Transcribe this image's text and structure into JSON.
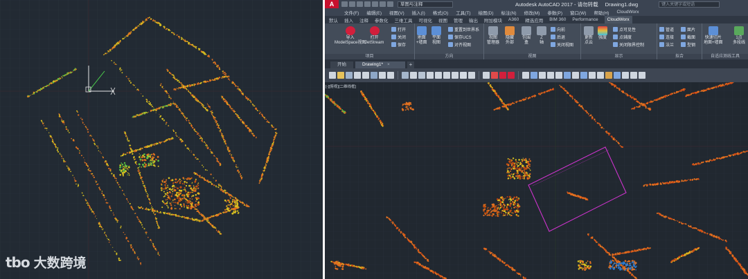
{
  "watermark": {
    "logo_text": "tbo",
    "text": "大数跨境"
  },
  "autocad": {
    "app_logo": "A",
    "workspace": "草图与注释",
    "title": "Autodesk AutoCAD 2017 - 请勿转载",
    "filename": "Drawing1.dwg",
    "search_placeholder": "键入关键字或短语",
    "menu": [
      "文件(F)",
      "编辑(E)",
      "视图(V)",
      "插入(I)",
      "格式(O)",
      "工具(T)",
      "绘图(D)",
      "标注(N)",
      "修改(M)",
      "参数(P)",
      "窗口(W)",
      "帮助(H)",
      "CloudWorx"
    ],
    "ribbon_tabs": [
      "默认",
      "插入",
      "注释",
      "参数化",
      "三维工具",
      "可视化",
      "视图",
      "管理",
      "输出",
      "附加模块",
      "A360",
      "精选应用",
      "BIM 360",
      "Performance",
      "CloudWorx"
    ],
    "ribbon_active_tab": "CloudWorx",
    "ribbon": {
      "import_label": "导入",
      "import_sub": "ModelSpace视图",
      "open_label": "打开",
      "open_sub": "JetStream",
      "small_open": "打开",
      "small_close": "关闭",
      "small_save": "保存",
      "project_panel": "项目",
      "ground_label": "地面",
      "ground_sub": "+墙面",
      "plane_label": "平面",
      "plane_sub": "视图",
      "reset_ucs": "重置到世界系",
      "save_ucs": "保存UCS",
      "align_view": "对齐视图",
      "direction_panel": "方向",
      "viewport_label": "视图",
      "viewport_sub": "管理器",
      "hide_label": "隐藏",
      "hide_sub": "外部",
      "bbox_label": "包围",
      "bbox_sub": "盒",
      "z_label": "Z",
      "z_sub": "轴",
      "fwd": "向前",
      "back": "后退",
      "close_view": "关闭视图",
      "view_panel": "视图",
      "update_label": "更新",
      "update_sub": "点云",
      "intensity_label": "强度",
      "pt_visible": "点可见性",
      "pt_size": "点辅度",
      "limit_box": "关闭限界控制",
      "display_panel": "显示",
      "pipe": "管道",
      "connect": "连接",
      "flange": "法兰",
      "patch": "面片",
      "section": "截面",
      "shape": "型钢",
      "fit_panel": "拟合",
      "quick_slice_label": "快速切片",
      "quick_slice_sub": "地面+墙面",
      "one_point_label": "1点",
      "one_point_sub": "多段线",
      "polyline_panel": "自适应测线工具"
    },
    "doc_tabs": [
      "开始",
      "Drawing1*"
    ],
    "view_label": "[-][俯视][二维线框]"
  },
  "colors": {
    "left_bg": "#222a33",
    "right_bg": "#212830",
    "pointcloud_orange": "#e07020",
    "pointcloud_yellow": "#d8c020",
    "pointcloud_green": "#5cc040",
    "selection_magenta": "#cc33cc",
    "ucs_white": "#e8e8e8",
    "ucs_green": "#4cd14c"
  }
}
